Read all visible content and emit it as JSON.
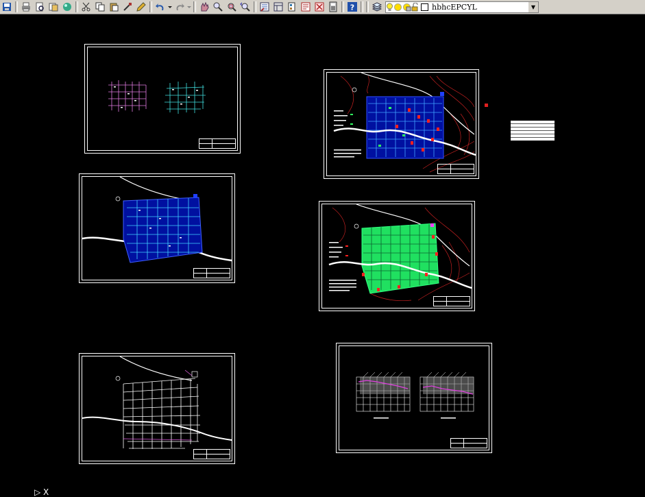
{
  "toolbar": {
    "buttons": [
      {
        "name": "save-icon",
        "color": "#2255aa"
      },
      {
        "name": "print-icon",
        "color": "#555555"
      },
      {
        "name": "plot-preview-icon",
        "color": "#555555"
      },
      {
        "name": "publish-icon",
        "color": "#886622"
      },
      {
        "name": "3d-dwf-icon",
        "color": "#22aa44"
      },
      {
        "name": "cut-icon",
        "color": "#333333"
      },
      {
        "name": "copy-icon",
        "color": "#333333"
      },
      {
        "name": "paste-icon",
        "color": "#aa7722"
      },
      {
        "name": "match-properties-icon",
        "color": "#aa3333"
      },
      {
        "name": "block-editor-icon",
        "color": "#aa8822"
      },
      {
        "name": "undo-icon",
        "color": "#2255aa"
      },
      {
        "name": "redo-icon",
        "color": "#888888"
      },
      {
        "name": "pan-icon",
        "color": "#aa44aa"
      },
      {
        "name": "zoom-realtime-icon",
        "color": "#555555"
      },
      {
        "name": "zoom-window-icon",
        "color": "#555555"
      },
      {
        "name": "zoom-previous-icon",
        "color": "#555555"
      },
      {
        "name": "properties-icon",
        "color": "#3355aa"
      },
      {
        "name": "design-center-icon",
        "color": "#335577"
      },
      {
        "name": "tool-palettes-icon",
        "color": "#555555"
      },
      {
        "name": "sheet-set-icon",
        "color": "#aa2222"
      },
      {
        "name": "markup-icon",
        "color": "#aa2222"
      },
      {
        "name": "calculator-icon",
        "color": "#444444"
      },
      {
        "name": "help-icon",
        "color": "#1f4faa"
      },
      {
        "name": "layer-properties-icon",
        "color": "#557799"
      }
    ],
    "layer": {
      "name": "hbhcEPCYL",
      "state_icons": [
        "lightbulb-on-icon",
        "sun-thaw-icon",
        "layer-freeze-viewport-icon",
        "lock-open-icon",
        "color-swatch-icon"
      ]
    }
  },
  "drawings": [
    {
      "id": "site-network-overview"
    },
    {
      "id": "topo-blue-network"
    },
    {
      "id": "blue-network-plan"
    },
    {
      "id": "green-network-plan"
    },
    {
      "id": "road-grid-plan"
    },
    {
      "id": "profile-sections"
    }
  ],
  "legend_table": {
    "rows": 5
  },
  "ucs": {
    "label": "▷  X"
  }
}
